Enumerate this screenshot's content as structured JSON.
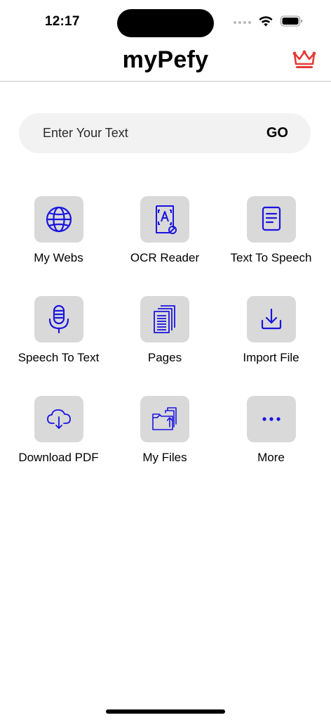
{
  "status_bar": {
    "time": "12:17"
  },
  "header": {
    "title": "myPefy",
    "crown_color": "#e53935"
  },
  "search": {
    "placeholder": "Enter Your Text",
    "go_label": "GO"
  },
  "accent_color": "#1a14e0",
  "tiles": [
    {
      "label": "My Webs",
      "icon": "globe-icon"
    },
    {
      "label": "OCR Reader",
      "icon": "ocr-scan-icon"
    },
    {
      "label": "Text To Speech",
      "icon": "document-text-icon"
    },
    {
      "label": "Speech To Text",
      "icon": "microphone-icon"
    },
    {
      "label": "Pages",
      "icon": "pages-stack-icon"
    },
    {
      "label": "Import File",
      "icon": "import-download-icon"
    },
    {
      "label": "Download PDF",
      "icon": "cloud-download-icon"
    },
    {
      "label": "My Files",
      "icon": "folder-upload-icon"
    },
    {
      "label": "More",
      "icon": "more-dots-icon"
    }
  ]
}
